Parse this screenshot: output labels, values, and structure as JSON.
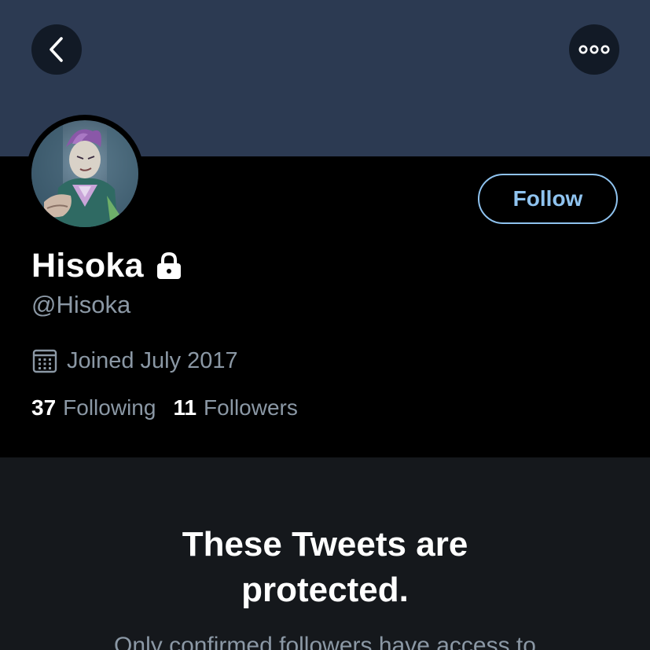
{
  "header": {
    "back_icon": "chevron-left-icon",
    "more_icon": "more-horizontal-icon",
    "banner_color": "#2c3a52"
  },
  "profile": {
    "display_name": "Hisoka",
    "locked_icon": "lock-icon",
    "handle": "@Hisoka",
    "joined_icon": "calendar-icon",
    "joined": "Joined July 2017",
    "follow_label": "Follow",
    "accent_color": "#8fc3ef"
  },
  "stats": {
    "following_count": "37",
    "following_label": "Following",
    "followers_count": "11",
    "followers_label": "Followers"
  },
  "protected": {
    "title_line1": "These Tweets are",
    "title_line2": "protected.",
    "subtitle": "Only confirmed followers have access to"
  }
}
